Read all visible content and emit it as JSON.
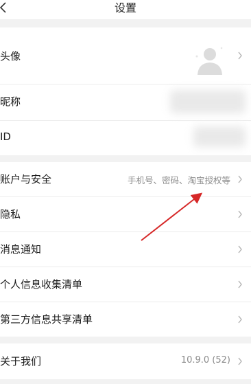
{
  "header": {
    "title": "设置"
  },
  "profile_group": {
    "avatar_label": "头像",
    "nickname_label": "昵称",
    "id_label": "ID"
  },
  "account_group": {
    "items": [
      {
        "label": "账户与安全",
        "value": "手机号、密码、淘宝授权等"
      },
      {
        "label": "隐私"
      },
      {
        "label": "消息通知"
      },
      {
        "label": "个人信息收集清单"
      },
      {
        "label": "第三方信息共享清单"
      }
    ]
  },
  "about_group": {
    "label": "关于我们",
    "version": "10.9.0 (52)"
  },
  "colors": {
    "background": "#f2f2f2",
    "card": "#ffffff",
    "annotation_arrow": "#d62828"
  },
  "icons": {
    "back": "chevron-left-icon",
    "row_arrow": "chevron-right-icon",
    "avatar": "default-avatar-icon"
  }
}
